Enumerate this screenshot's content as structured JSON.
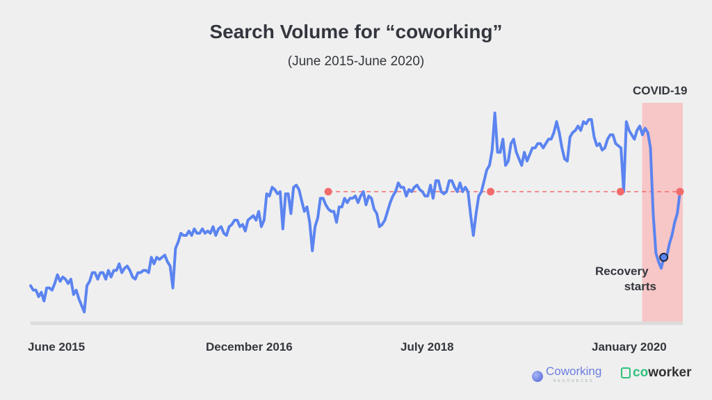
{
  "title": "Search Volume for “coworking”",
  "subtitle": "(June 2015-June 2020)",
  "annotations": {
    "covid_label": "COVID-19",
    "recovery_label_line1": "Recovery",
    "recovery_label_line2": "starts"
  },
  "logos": {
    "logo1_main": "Coworking",
    "logo1_sub": "RESOURCES",
    "logo2_prefix": "co",
    "logo2_main": "worker"
  },
  "colors": {
    "line": "#5b84f0",
    "marker": "#f26b6b",
    "covid_band": "#f7c6c6",
    "baseline": "#dcdcdc"
  },
  "chart_data": {
    "type": "line",
    "title": "Search Volume for “coworking”",
    "subtitle": "(June 2015-June 2020)",
    "xlabel": "",
    "ylabel": "",
    "x_range_months": [
      0,
      60
    ],
    "ylim": [
      0,
      100
    ],
    "grid": false,
    "x_tick_labels": [
      {
        "label": "June 2015",
        "month": 0
      },
      {
        "label": "December 2016",
        "month": 18
      },
      {
        "label": "July 2018",
        "month": 37
      },
      {
        "label": "January 2020",
        "month": 55
      }
    ],
    "reference_level": 60,
    "covid_period_months": [
      56.5,
      60
    ],
    "highlight_points_months": [
      27.5,
      42.5,
      54.5,
      60
    ],
    "recovery_point_month": 58.5,
    "series": [
      {
        "name": "coworking",
        "values": [
          17,
          15,
          15,
          12,
          14,
          10,
          16,
          16,
          15,
          18,
          22,
          19,
          21,
          20,
          18,
          20,
          13,
          15,
          11,
          8,
          5,
          17,
          19,
          23,
          23,
          20,
          23,
          23,
          20,
          24,
          21,
          24,
          24,
          27,
          23,
          25,
          26,
          24,
          21,
          20,
          23,
          23,
          24,
          24,
          23,
          30,
          27,
          30,
          29,
          30,
          31,
          28,
          26,
          16,
          34,
          37,
          41,
          40,
          40,
          42,
          40,
          43,
          41,
          41,
          43,
          41,
          42,
          41,
          44,
          40,
          43,
          44,
          41,
          40,
          44,
          45,
          47,
          47,
          44,
          45,
          42,
          47,
          48,
          49,
          47,
          51,
          44,
          47,
          59,
          58,
          62,
          61,
          59,
          60,
          43,
          59,
          59,
          50,
          62,
          63,
          61,
          56,
          51,
          53,
          46,
          33,
          44,
          48,
          57,
          57,
          54,
          52,
          51,
          51,
          46,
          53,
          53,
          57,
          55,
          57,
          57,
          58,
          55,
          58,
          60,
          54,
          58,
          57,
          52,
          50,
          44,
          45,
          47,
          51,
          55,
          58,
          60,
          64,
          62,
          62,
          58,
          61,
          60,
          62,
          63,
          61,
          60,
          58,
          58,
          63,
          57,
          65,
          65,
          60,
          59,
          60,
          65,
          65,
          62,
          60,
          64,
          60,
          62,
          60,
          49,
          40,
          50,
          58,
          60,
          65,
          70,
          72,
          79,
          96,
          78,
          78,
          84,
          72,
          74,
          82,
          84,
          78,
          75,
          72,
          78,
          74,
          77,
          80,
          80,
          82,
          82,
          80,
          82,
          84,
          84,
          87,
          92,
          87,
          80,
          75,
          74,
          85,
          87,
          88,
          90,
          88,
          92,
          91,
          93,
          93,
          85,
          81,
          82,
          79,
          80,
          84,
          86,
          86,
          82,
          81,
          80,
          60,
          92,
          88,
          86,
          84,
          88,
          90,
          86,
          89,
          87,
          80,
          50,
          32,
          28,
          25,
          30,
          30,
          36,
          40,
          46,
          50,
          60
        ]
      }
    ]
  }
}
